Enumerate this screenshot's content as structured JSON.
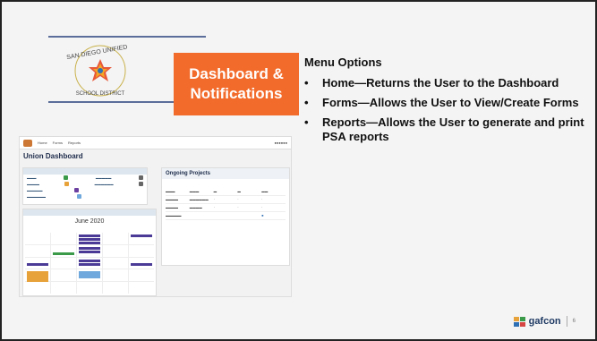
{
  "title_box": {
    "line1": "Dashboard &",
    "line2": "Notifications"
  },
  "menu": {
    "heading": "Menu Options",
    "items": [
      {
        "label": "Home—Returns the User to the Dashboard"
      },
      {
        "label": "Forms—Allows the User to View/Create Forms"
      },
      {
        "label": "Reports—Allows the User to generate and print PSA reports"
      }
    ]
  },
  "logo": {
    "alt_text": "SAN DIEGO UNIFIED SCHOOL DISTRICT"
  },
  "dashboard": {
    "title": "Union Dashboard",
    "nav": [
      "Home",
      "Forms",
      "Reports"
    ],
    "calendar_month": "June 2020",
    "ongoing_title": "Ongoing Projects"
  },
  "footer": {
    "brand": "gafcon",
    "page": "6"
  },
  "colors": {
    "accent": "#f26b2b",
    "brand_navy": "#1f3a63"
  }
}
